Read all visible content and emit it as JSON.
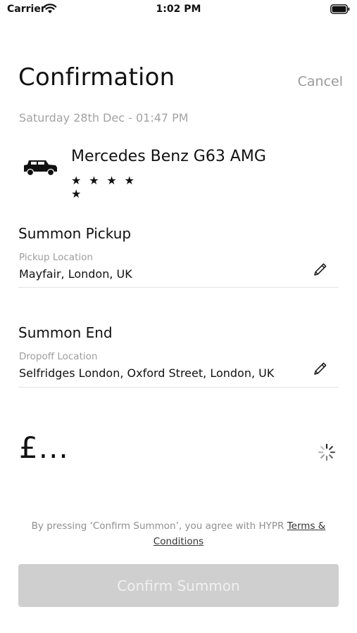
{
  "status_bar": {
    "carrier": "Carrier",
    "time": "1:02 PM"
  },
  "header": {
    "title": "Confirmation",
    "cancel_label": "Cancel"
  },
  "booking": {
    "datetime": "Saturday 28th Dec - 01:47 PM"
  },
  "car": {
    "name": "Mercedes Benz G63 AMG",
    "rating": 5,
    "rating_stars": "★★★★★"
  },
  "pickup": {
    "section_title": "Summon Pickup",
    "label": "Pickup Location",
    "value": "Mayfair, London, UK"
  },
  "dropoff": {
    "section_title": "Summon End",
    "label": "Dropoff Location",
    "value": "Selfridges London, Oxford Street, London, UK"
  },
  "price": {
    "value": "£..."
  },
  "terms": {
    "prefix": "By pressing ‘Confirm Summon’, you agree with HYPR",
    "link": "Terms & Conditions"
  },
  "confirm_button": {
    "label": "Confirm Summon"
  },
  "colors": {
    "text": "#111111",
    "muted": "#9a9a9a",
    "disabled_button": "#cfcfcf",
    "divider": "#e3e3e3"
  }
}
